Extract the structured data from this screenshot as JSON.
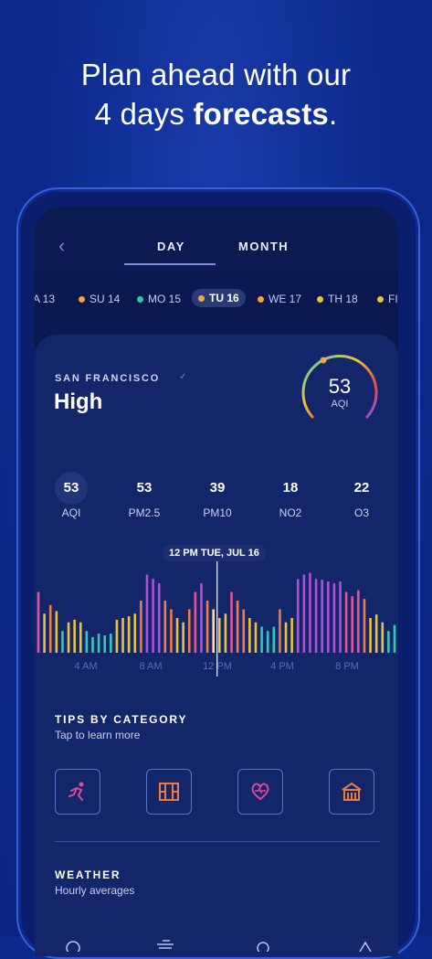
{
  "headline": {
    "line1": "Plan ahead with our",
    "line2_prefix": "4 days ",
    "line2_bold": "forecasts",
    "line2_suffix": "."
  },
  "tabs": [
    {
      "label": "DAY",
      "selected": true
    },
    {
      "label": "MONTH",
      "selected": false
    }
  ],
  "dates": [
    {
      "label": "A 13",
      "color": "#c9a03a"
    },
    {
      "label": "SU 14",
      "color": "#f0a640"
    },
    {
      "label": "MO 15",
      "color": "#2fc6b3"
    },
    {
      "label": "TU 16",
      "color": "#f0a640",
      "selected": true
    },
    {
      "label": "WE 17",
      "color": "#f0a640"
    },
    {
      "label": "TH 18",
      "color": "#e8c23a"
    },
    {
      "label": "FI",
      "color": "#e8c23a"
    }
  ],
  "location": {
    "city": "SAN FRANCISCO",
    "level": "High",
    "aqi_value": "53",
    "aqi_label": "AQI"
  },
  "metrics": [
    {
      "value": "53",
      "label": "AQI"
    },
    {
      "value": "53",
      "label": "PM2.5"
    },
    {
      "value": "39",
      "label": "PM10"
    },
    {
      "value": "18",
      "label": "NO2"
    },
    {
      "value": "22",
      "label": "O3"
    }
  ],
  "chart_data": {
    "type": "bar",
    "tooltip": "12 PM  TUE, JUL 16",
    "x_ticks": [
      "4 AM",
      "8 AM",
      "12 PM",
      "4 PM",
      "8 PM"
    ],
    "values": [
      70,
      45,
      55,
      48,
      25,
      35,
      38,
      35,
      25,
      18,
      22,
      20,
      22,
      38,
      40,
      42,
      45,
      60,
      90,
      85,
      80,
      60,
      50,
      40,
      35,
      50,
      70,
      80,
      60,
      50,
      40,
      45,
      70,
      60,
      50,
      40,
      35,
      30,
      25,
      30,
      50,
      35,
      40,
      85,
      90,
      92,
      85,
      84,
      82,
      80,
      82,
      70,
      65,
      72,
      62,
      40,
      44,
      35,
      25,
      32
    ],
    "selected_index": 29
  },
  "tips": {
    "title": "TIPS BY CATEGORY",
    "subtitle": "Tap to learn more",
    "icons": [
      "runner-icon",
      "window-icon",
      "heart-icon",
      "house-icon"
    ]
  },
  "weather": {
    "title": "WEATHER",
    "subtitle": "Hourly averages"
  },
  "colors": {
    "accent": "#f0a640",
    "background": "#0c2a8c"
  }
}
